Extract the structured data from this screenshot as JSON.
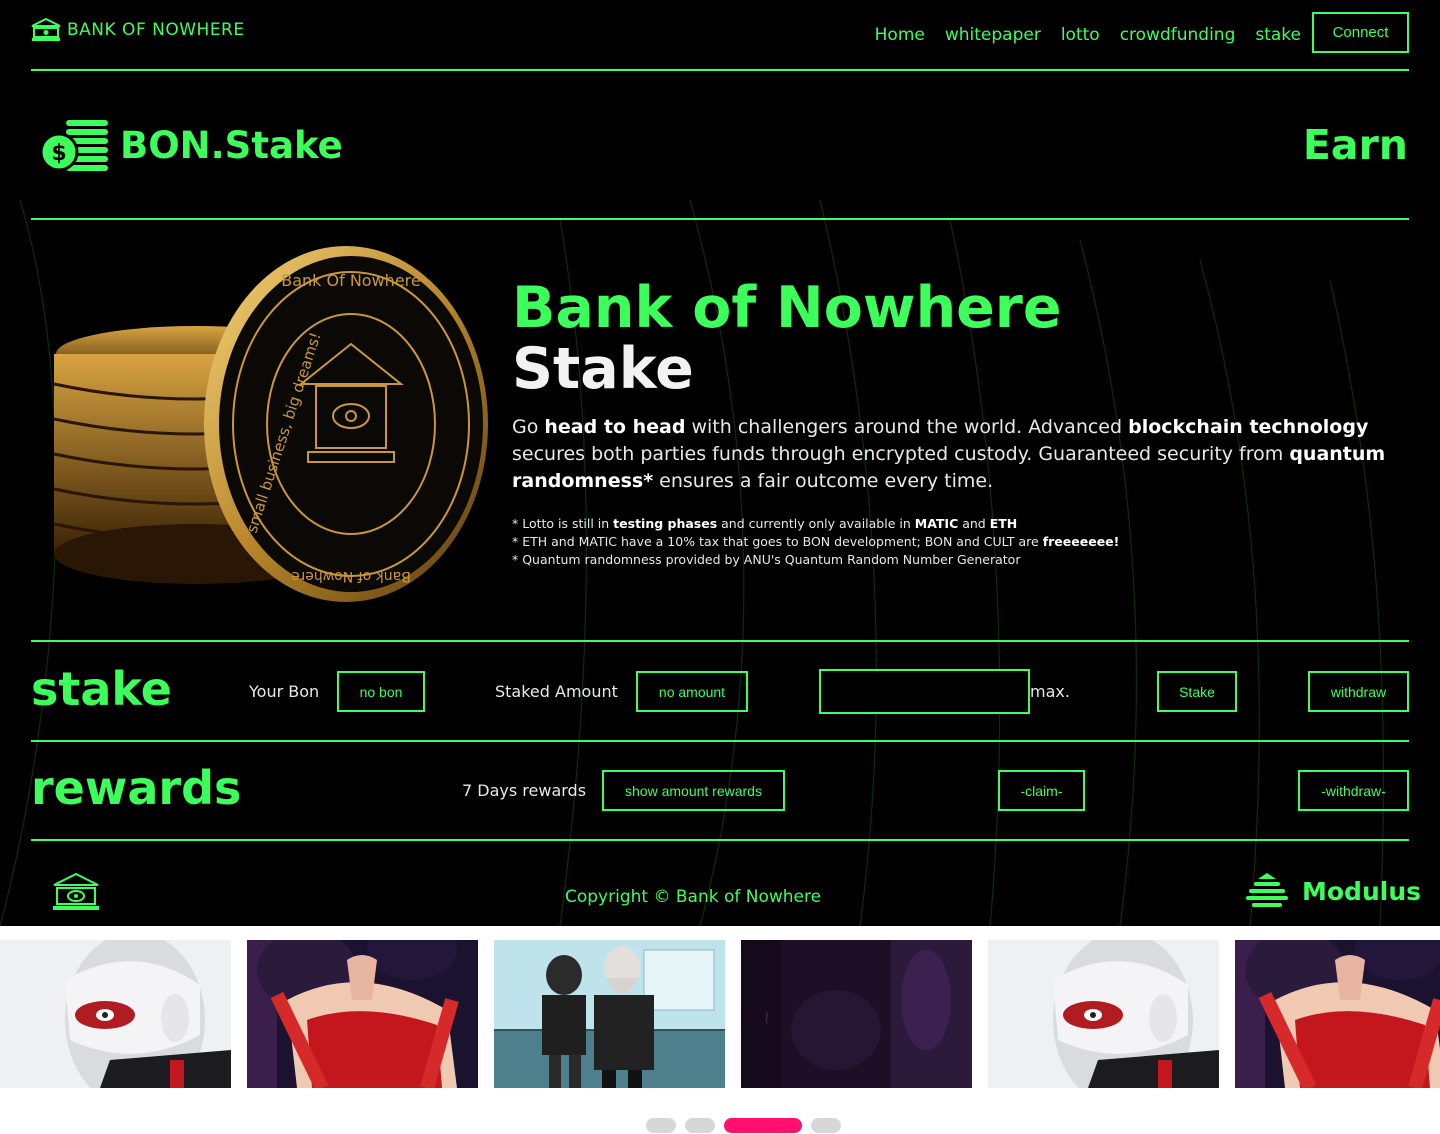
{
  "nav": {
    "brand": "BANK OF NOWHERE",
    "links": [
      "Home",
      "whitepaper",
      "lotto",
      "crowdfunding",
      "stake"
    ],
    "connect_label": "Connect"
  },
  "header": {
    "title": "BON.Stake",
    "right_label": "Earn"
  },
  "hero": {
    "title_line1": "Bank of Nowhere",
    "title_line2": "Stake",
    "lead": {
      "p1": "Go ",
      "b1": "head to head",
      "p2": " with challengers around the world. Advanced ",
      "b2": "blockchain technology",
      "p3": " secures both parties funds through encrypted custody. Guaranteed security from ",
      "b3": "quantum randomness*",
      "p4": " ensures a fair outcome every time."
    },
    "note1": {
      "a": "* Lotto is still in ",
      "b": "testing phases",
      "c": " and currently only available in ",
      "d": "MATIC",
      "e": " and ",
      "f": "ETH"
    },
    "note2": {
      "a": "* ETH and MATIC have a 10% tax that goes to BON development; BON and CULT are ",
      "b": "freeeeeee!"
    },
    "note3": "* Quantum randomness provided by ANU's Quantum Random Number Generator",
    "coin_text_top": "Bank Of Nowhere",
    "coin_text_side": "small business, big dreams!",
    "coin_text_bottom": "Bank of Nowhere"
  },
  "stake": {
    "title": "stake",
    "your_bon_label": "Your Bon",
    "your_bon_value": "no bon",
    "staked_label": "Staked Amount",
    "staked_value": "no amount",
    "amount_placeholder": "",
    "max_label": "max.",
    "stake_button": "Stake",
    "withdraw_button": "withdraw"
  },
  "rewards": {
    "title": "rewards",
    "days_label": "7 Days rewards",
    "show_button": "show amount rewards",
    "claim_button": "-claim-",
    "withdraw_button": "-withdraw-"
  },
  "footer": {
    "copyright": "Copyright © Bank of Nowhere",
    "modulus": "Modulus"
  },
  "gallery": {
    "dot_count": 4,
    "active_dot": 2
  },
  "colors": {
    "accent": "#3dff5c",
    "background": "#000000",
    "active_dot": "#ff0f6e",
    "dot": "#d7d7d7"
  }
}
